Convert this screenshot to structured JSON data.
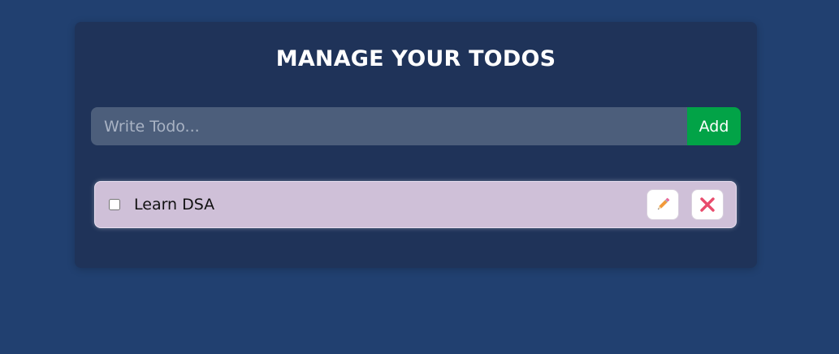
{
  "header": {
    "title": "MANAGE YOUR TODOS"
  },
  "form": {
    "placeholder": "Write Todo...",
    "value": "",
    "add_label": "Add"
  },
  "todos": [
    {
      "text": "Learn DSA",
      "completed": false
    }
  ],
  "icons": {
    "edit": "pencil-icon",
    "delete": "cross-icon"
  },
  "colors": {
    "background": "#214070",
    "card": "#1f3359",
    "input": "#4c5e7b",
    "add_button": "#02a347",
    "todo_item": "#cfc0d8",
    "delete_icon": "#e84b6c",
    "edit_icon": "#e8823a"
  }
}
